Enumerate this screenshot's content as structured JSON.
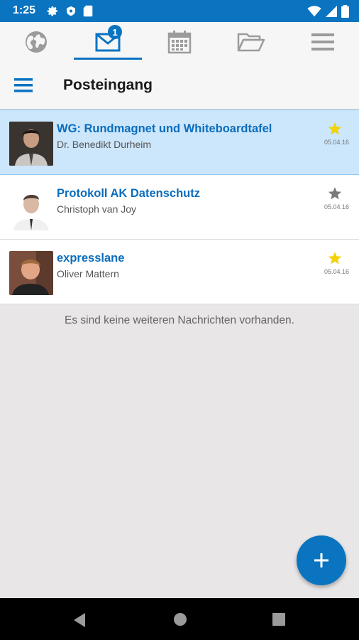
{
  "status_bar": {
    "time": "1:25"
  },
  "tabs": [
    {
      "name": "web",
      "icon": "globe-icon"
    },
    {
      "name": "mail",
      "icon": "envelope-icon",
      "badge": "1"
    },
    {
      "name": "calendar",
      "icon": "calendar-icon"
    },
    {
      "name": "files",
      "icon": "folder-icon"
    },
    {
      "name": "menu",
      "icon": "menu-icon"
    }
  ],
  "header": {
    "title": "Posteingang"
  },
  "messages": [
    {
      "subject": "WG: Rundmagnet und Whiteboardtafel",
      "sender": "Dr. Benedikt Durheim",
      "date": "05.04.16",
      "starred": true,
      "selected": true
    },
    {
      "subject": "Protokoll AK Datenschutz",
      "sender": "Christoph van Joy",
      "date": "05.04.16",
      "starred": false,
      "selected": false
    },
    {
      "subject": "expresslane",
      "sender": "Oliver Mattern",
      "date": "05.04.16",
      "starred": true,
      "selected": false
    }
  ],
  "empty_text": "Es sind keine weiteren Nachrichten vorhanden.",
  "colors": {
    "accent": "#0a74c1",
    "star_active": "#f3d20b",
    "star_inactive": "#7a7a7a",
    "selected_row": "#cce6fb"
  }
}
